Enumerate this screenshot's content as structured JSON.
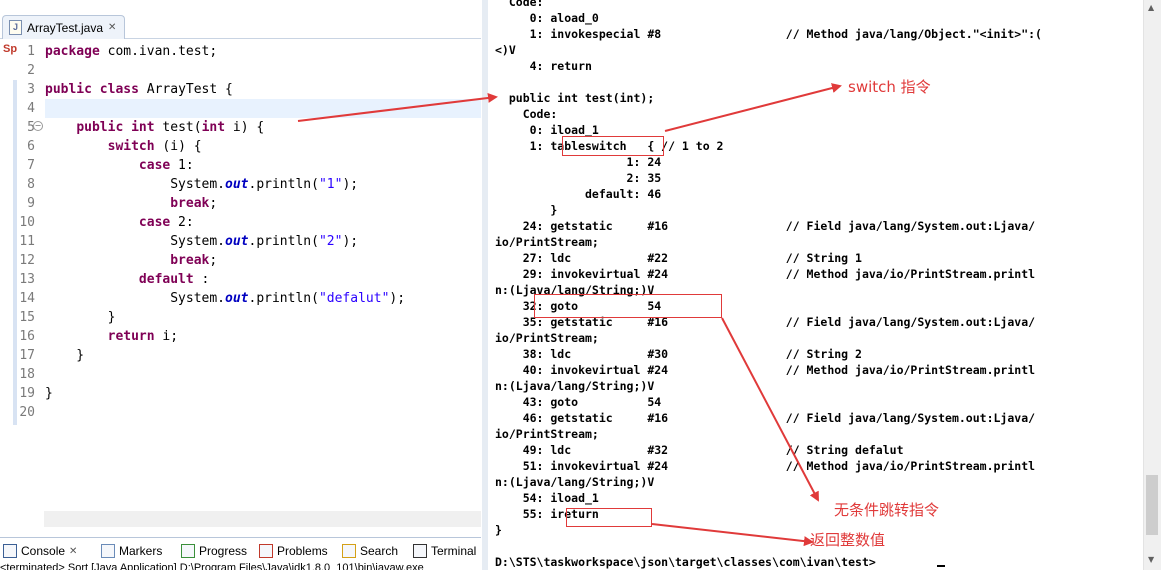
{
  "editor": {
    "tab_label": "ArrayTest.java",
    "ruler_marker": "Sp",
    "line_numbers": [
      "1",
      "2",
      "3",
      "4",
      "5",
      "6",
      "7",
      "8",
      "9",
      "10",
      "11",
      "12",
      "13",
      "14",
      "15",
      "16",
      "17",
      "18",
      "19",
      "20"
    ]
  },
  "console_view": {
    "tabs": [
      {
        "label": "Console",
        "icon": "console-icon",
        "active": true
      },
      {
        "label": "Markers",
        "icon": "markers-icon"
      },
      {
        "label": "Progress",
        "icon": "progress-icon"
      },
      {
        "label": "Problems",
        "icon": "problems-icon"
      },
      {
        "label": "Search",
        "icon": "search-icon"
      },
      {
        "label": "Terminal",
        "icon": "terminal-icon"
      }
    ],
    "status": "<terminated> Sort [Java Application] D:\\Program Files\\Java\\jdk1.8.0_101\\bin\\javaw.exe"
  },
  "terminal": {
    "lines": [
      "  Code:",
      "     0: aload_0",
      "     1: invokespecial #8                  // Method java/lang/Object.\"<init>\":(",
      "<)V",
      "     4: return",
      "",
      "  public int test(int);",
      "    Code:",
      "     0: iload_1",
      "     1: tableswitch   { // 1 to 2",
      "                   1: 24",
      "                   2: 35",
      "             default: 46",
      "        }",
      "    24: getstatic     #16                 // Field java/lang/System.out:Ljava/",
      "io/PrintStream;",
      "    27: ldc           #22                 // String 1",
      "    29: invokevirtual #24                 // Method java/io/PrintStream.printl",
      "n:(Ljava/lang/String;)V",
      "    32: goto          54",
      "    35: getstatic     #16                 // Field java/lang/System.out:Ljava/",
      "io/PrintStream;",
      "    38: ldc           #30                 // String 2",
      "    40: invokevirtual #24                 // Method java/io/PrintStream.printl",
      "n:(Ljava/lang/String;)V",
      "    43: goto          54",
      "    46: getstatic     #16                 // Field java/lang/System.out:Ljava/",
      "io/PrintStream;",
      "    49: ldc           #32                 // String defalut",
      "    51: invokevirtual #24                 // Method java/io/PrintStream.printl",
      "n:(Ljava/lang/String;)V",
      "    54: iload_1",
      "    55: ireturn",
      "}",
      "",
      "D:\\STS\\taskworkspace\\json\\target\\classes\\com\\ivan\\test>"
    ]
  },
  "annotations": {
    "switch_label": "switch 指令",
    "goto_label": "无条件跳转指令",
    "return_label": "返回整数值"
  },
  "colors": {
    "keyword": "#7f0055",
    "string": "#2a00ff",
    "static_field": "#0000c0",
    "annotation_red": "#e03a3a",
    "current_line": "#e8f2fe"
  }
}
